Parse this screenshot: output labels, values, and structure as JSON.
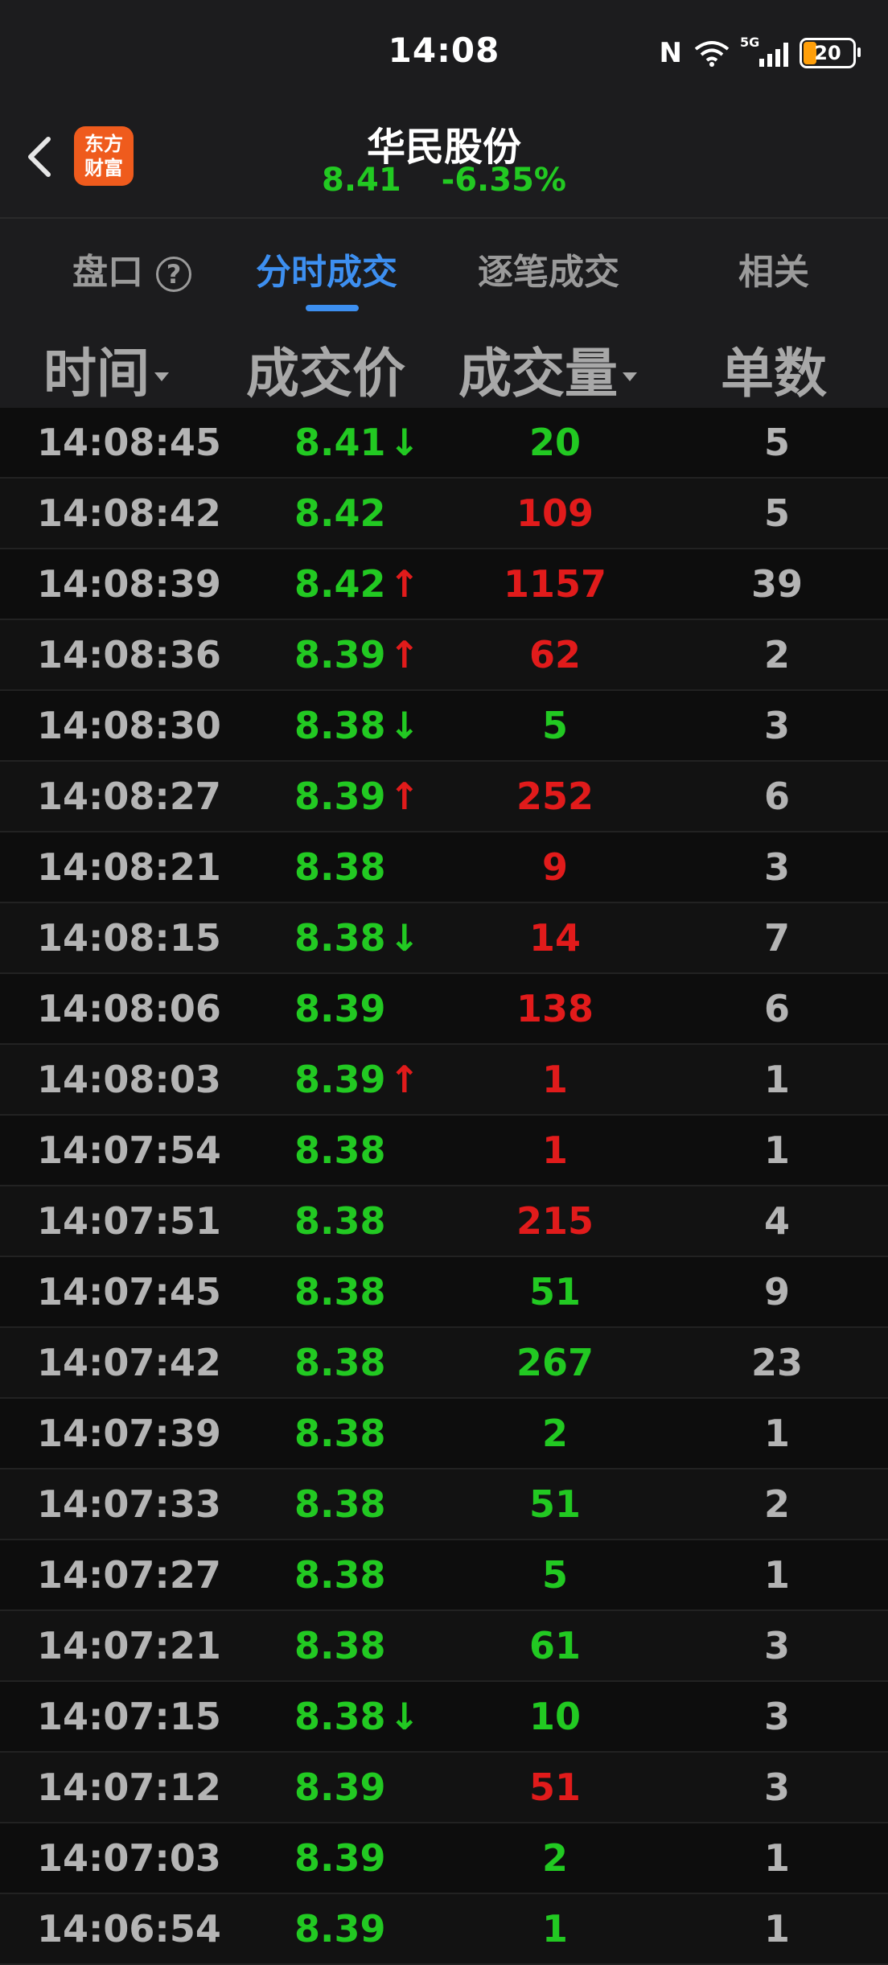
{
  "status_bar": {
    "time": "14:08",
    "nfc": "N",
    "signal_label": "5G",
    "battery": "20"
  },
  "header": {
    "logo_line1": "东方",
    "logo_line2": "财富",
    "stock_name": "华民股份",
    "price": "8.41",
    "change_pct": "-6.35%"
  },
  "tabs": [
    {
      "label": "盘口"
    },
    {
      "label": "分时成交"
    },
    {
      "label": "逐笔成交"
    },
    {
      "label": "相关"
    }
  ],
  "help_icon": "?",
  "table": {
    "headers": [
      "时间",
      "成交价",
      "成交量",
      "单数"
    ],
    "rows": [
      {
        "time": "14:08:45",
        "price": "8.41",
        "arrow": "↓",
        "arrow_color": "green",
        "volume": "20",
        "vol_color": "green",
        "count": "5"
      },
      {
        "time": "14:08:42",
        "price": "8.42",
        "arrow": "",
        "arrow_color": "",
        "volume": "109",
        "vol_color": "red",
        "count": "5"
      },
      {
        "time": "14:08:39",
        "price": "8.42",
        "arrow": "↑",
        "arrow_color": "red",
        "volume": "1157",
        "vol_color": "red",
        "count": "39"
      },
      {
        "time": "14:08:36",
        "price": "8.39",
        "arrow": "↑",
        "arrow_color": "red",
        "volume": "62",
        "vol_color": "red",
        "count": "2"
      },
      {
        "time": "14:08:30",
        "price": "8.38",
        "arrow": "↓",
        "arrow_color": "green",
        "volume": "5",
        "vol_color": "green",
        "count": "3"
      },
      {
        "time": "14:08:27",
        "price": "8.39",
        "arrow": "↑",
        "arrow_color": "red",
        "volume": "252",
        "vol_color": "red",
        "count": "6"
      },
      {
        "time": "14:08:21",
        "price": "8.38",
        "arrow": "",
        "arrow_color": "",
        "volume": "9",
        "vol_color": "red",
        "count": "3"
      },
      {
        "time": "14:08:15",
        "price": "8.38",
        "arrow": "↓",
        "arrow_color": "green",
        "volume": "14",
        "vol_color": "red",
        "count": "7"
      },
      {
        "time": "14:08:06",
        "price": "8.39",
        "arrow": "",
        "arrow_color": "",
        "volume": "138",
        "vol_color": "red",
        "count": "6"
      },
      {
        "time": "14:08:03",
        "price": "8.39",
        "arrow": "↑",
        "arrow_color": "red",
        "volume": "1",
        "vol_color": "red",
        "count": "1"
      },
      {
        "time": "14:07:54",
        "price": "8.38",
        "arrow": "",
        "arrow_color": "",
        "volume": "1",
        "vol_color": "red",
        "count": "1"
      },
      {
        "time": "14:07:51",
        "price": "8.38",
        "arrow": "",
        "arrow_color": "",
        "volume": "215",
        "vol_color": "red",
        "count": "4"
      },
      {
        "time": "14:07:45",
        "price": "8.38",
        "arrow": "",
        "arrow_color": "",
        "volume": "51",
        "vol_color": "green",
        "count": "9"
      },
      {
        "time": "14:07:42",
        "price": "8.38",
        "arrow": "",
        "arrow_color": "",
        "volume": "267",
        "vol_color": "green",
        "count": "23"
      },
      {
        "time": "14:07:39",
        "price": "8.38",
        "arrow": "",
        "arrow_color": "",
        "volume": "2",
        "vol_color": "green",
        "count": "1"
      },
      {
        "time": "14:07:33",
        "price": "8.38",
        "arrow": "",
        "arrow_color": "",
        "volume": "51",
        "vol_color": "green",
        "count": "2"
      },
      {
        "time": "14:07:27",
        "price": "8.38",
        "arrow": "",
        "arrow_color": "",
        "volume": "5",
        "vol_color": "green",
        "count": "1"
      },
      {
        "time": "14:07:21",
        "price": "8.38",
        "arrow": "",
        "arrow_color": "",
        "volume": "61",
        "vol_color": "green",
        "count": "3"
      },
      {
        "time": "14:07:15",
        "price": "8.38",
        "arrow": "↓",
        "arrow_color": "green",
        "volume": "10",
        "vol_color": "green",
        "count": "3"
      },
      {
        "time": "14:07:12",
        "price": "8.39",
        "arrow": "",
        "arrow_color": "",
        "volume": "51",
        "vol_color": "red",
        "count": "3"
      },
      {
        "time": "14:07:03",
        "price": "8.39",
        "arrow": "",
        "arrow_color": "",
        "volume": "2",
        "vol_color": "green",
        "count": "1"
      },
      {
        "time": "14:06:54",
        "price": "8.39",
        "arrow": "",
        "arrow_color": "",
        "volume": "1",
        "vol_color": "green",
        "count": "1"
      }
    ]
  }
}
